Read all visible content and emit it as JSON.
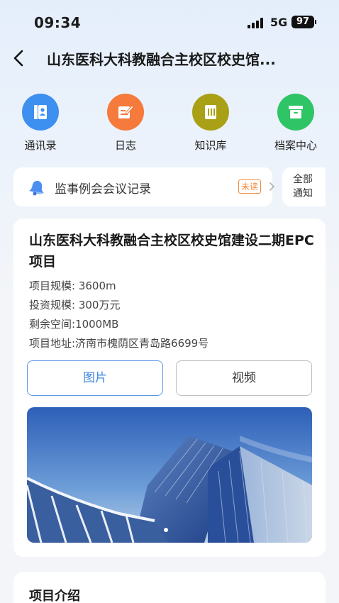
{
  "status_bar": {
    "time": "09:34",
    "network": "5G",
    "battery": "97"
  },
  "header": {
    "title": "山东医科大科教融合主校区校史馆..."
  },
  "quick_actions": [
    {
      "label": "通讯录",
      "icon": "contacts-icon",
      "color": "#3d8ff0"
    },
    {
      "label": "日志",
      "icon": "log-icon",
      "color": "#f57a3c"
    },
    {
      "label": "知识库",
      "icon": "knowledge-icon",
      "color": "#a9a016"
    },
    {
      "label": "档案中心",
      "icon": "archive-icon",
      "color": "#2fc567"
    }
  ],
  "notice": {
    "text": "监事例会会议记录",
    "badge": "未读",
    "all_line1": "全部",
    "all_line2": "通知"
  },
  "project": {
    "title": "山东医科大科教融合主校区校史馆建设二期EPC项目",
    "scale": "项目规模: 3600m",
    "investment": "投资规模: 300万元",
    "space": "剩余空间:1000MB",
    "address": "项目地址:济南市槐荫区青岛路6699号",
    "tab_images": "图片",
    "tab_video": "视频"
  },
  "intro": {
    "title": "项目介绍"
  }
}
